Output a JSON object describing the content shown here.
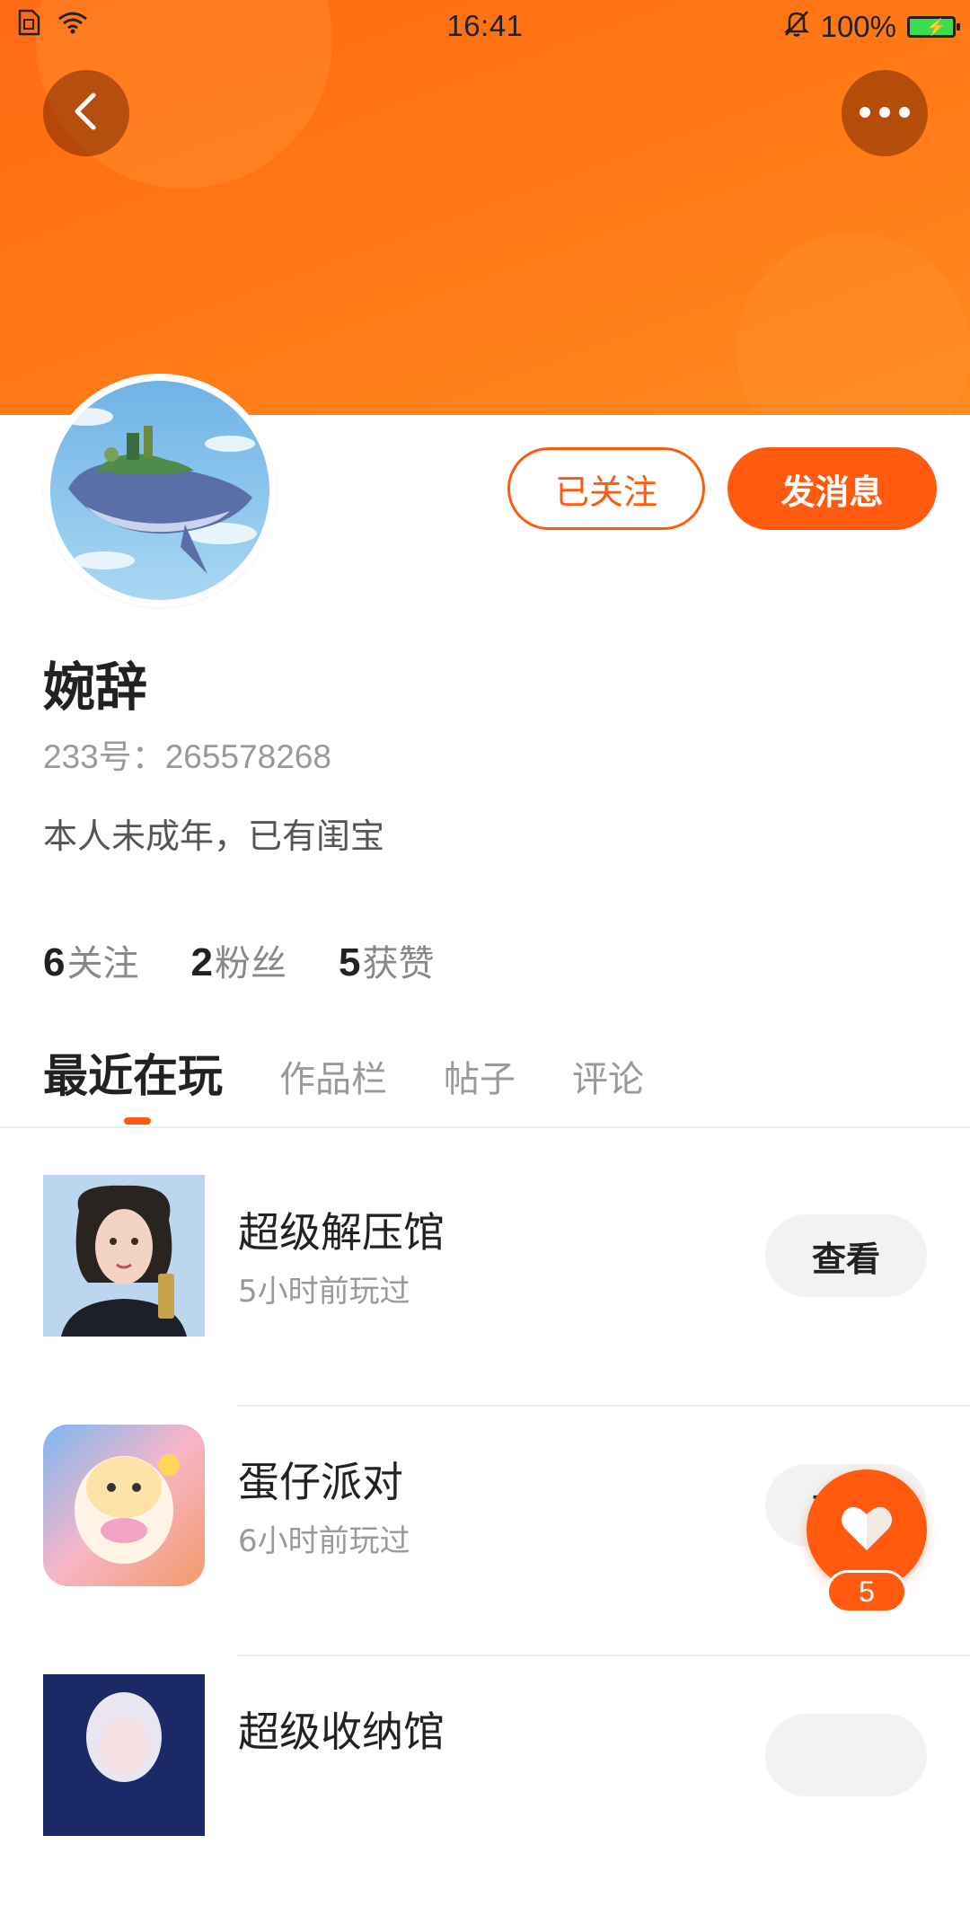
{
  "status_bar": {
    "time": "16:41",
    "battery_text": "100%"
  },
  "profile": {
    "followed_label": "已关注",
    "message_label": "发消息",
    "name": "婉辞",
    "id_text": "233号：265578268",
    "bio": "本人未成年，已有闺宝"
  },
  "stats": {
    "following_count": "6",
    "following_label": "关注",
    "fans_count": "2",
    "fans_label": "粉丝",
    "likes_count": "5",
    "likes_label": "获赞"
  },
  "tabs": [
    {
      "label": "最近在玩",
      "active": true
    },
    {
      "label": "作品栏",
      "active": false
    },
    {
      "label": "帖子",
      "active": false
    },
    {
      "label": "评论",
      "active": false
    }
  ],
  "games": [
    {
      "title": "超级解压馆",
      "time": "5小时前玩过",
      "button": "查看"
    },
    {
      "title": "蛋仔派对",
      "time": "6小时前玩过",
      "button": "查看"
    },
    {
      "title": "超级收纳馆",
      "time": "",
      "button": ""
    }
  ],
  "fab": {
    "like_count": "5"
  },
  "colors": {
    "accent": "#ff5a0f",
    "banner": "#ff7a16",
    "text_primary": "#222222",
    "text_secondary": "#9a9a9a"
  }
}
